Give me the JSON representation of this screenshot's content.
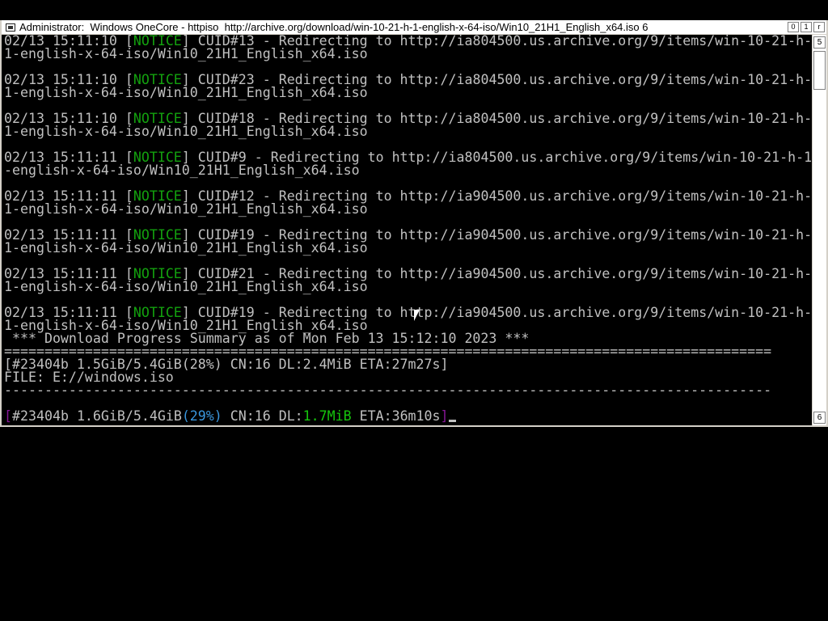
{
  "window": {
    "title": "Administrator:  Windows OneCore - httpiso  http://archive.org/download/win-10-21-h-1-english-x-64-iso/Win10_21H1_English_x64.iso 6",
    "buttons": [
      "0",
      "1",
      "r"
    ]
  },
  "scrollbar": {
    "up": "5",
    "down": "6"
  },
  "console": {
    "notices": [
      {
        "ts": "02/13 15:11:10 ",
        "tag": "NOTICE",
        "msg": " CUID#13 - Redirecting to http://ia804500.us.archive.org/9/items/win-10-21-h-",
        "wrap": "1-english-x-64-iso/Win10_21H1_English_x64.iso"
      },
      {
        "ts": "02/13 15:11:10 ",
        "tag": "NOTICE",
        "msg": " CUID#23 - Redirecting to http://ia804500.us.archive.org/9/items/win-10-21-h-",
        "wrap": "1-english-x-64-iso/Win10_21H1_English_x64.iso"
      },
      {
        "ts": "02/13 15:11:10 ",
        "tag": "NOTICE",
        "msg": " CUID#18 - Redirecting to http://ia804500.us.archive.org/9/items/win-10-21-h-",
        "wrap": "1-english-x-64-iso/Win10_21H1_English_x64.iso"
      },
      {
        "ts": "02/13 15:11:11 ",
        "tag": "NOTICE",
        "msg": " CUID#9 - Redirecting to http://ia804500.us.archive.org/9/items/win-10-21-h-1",
        "wrap": "-english-x-64-iso/Win10_21H1_English_x64.iso"
      },
      {
        "ts": "02/13 15:11:11 ",
        "tag": "NOTICE",
        "msg": " CUID#12 - Redirecting to http://ia904500.us.archive.org/9/items/win-10-21-h-",
        "wrap": "1-english-x-64-iso/Win10_21H1_English_x64.iso"
      },
      {
        "ts": "02/13 15:11:11 ",
        "tag": "NOTICE",
        "msg": " CUID#19 - Redirecting to http://ia904500.us.archive.org/9/items/win-10-21-h-",
        "wrap": "1-english-x-64-iso/Win10_21H1_English_x64.iso"
      },
      {
        "ts": "02/13 15:11:11 ",
        "tag": "NOTICE",
        "msg": " CUID#21 - Redirecting to http://ia904500.us.archive.org/9/items/win-10-21-h-",
        "wrap": "1-english-x-64-iso/Win10_21H1_English_x64.iso"
      },
      {
        "ts": "02/13 15:11:11 ",
        "tag": "NOTICE",
        "msg": " CUID#19 - Redirecting to http://ia904500.us.archive.org/9/items/win-10-21-h-",
        "wrap": "1-english-x-64-iso/Win10_21H1_English_x64.iso"
      }
    ],
    "summary_header": " *** Download Progress Summary as of Mon Feb 13 15:12:10 2023 ***",
    "double_rule": "===============================================================================================",
    "summary_line": "[#23404b 1.5GiB/5.4GiB(28%) CN:16 DL:2.4MiB ETA:27m27s]",
    "file_line": "FILE: E://windows.iso",
    "single_rule": "-----------------------------------------------------------------------------------------------",
    "progress": {
      "open": "[",
      "id": "#23404b ",
      "size": "1.6GiB/5.4GiB",
      "percent": "(29%)",
      "cn": " CN:16 DL:",
      "speed": "1.7MiB",
      "eta": " ETA:36m10s",
      "close": "]"
    }
  }
}
